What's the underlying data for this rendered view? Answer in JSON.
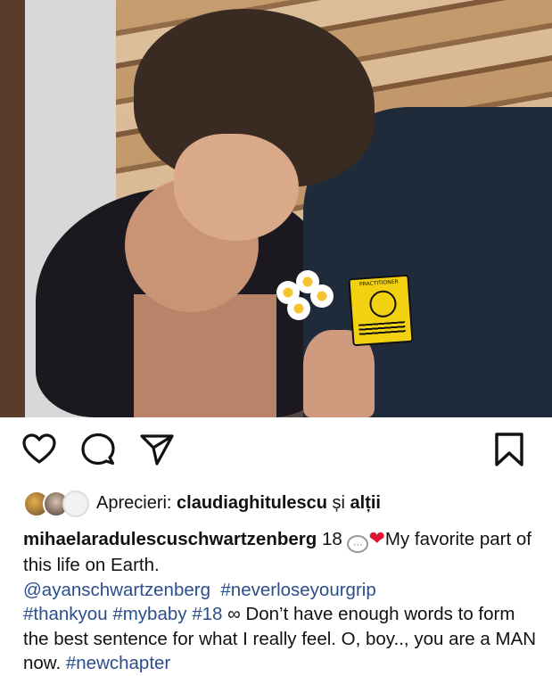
{
  "post": {
    "photo_badge_text": "PRACTITIONER",
    "likes": {
      "prefix": "Aprecieri: ",
      "user": "claudiaghitulescu",
      "conj": " și ",
      "others": "alții"
    },
    "caption": {
      "username": "mihaelaradulescuschwartzenberg",
      "number": " 18 ",
      "speech_bubble": "···",
      "heart": "❤",
      "line1": "My favorite part of this life on Earth.",
      "mention": "@ayanschwartzenberg",
      "tag1": "#neverloseyourgrip",
      "tag2": "#thankyou",
      "tag3": "#mybaby",
      "tag4": "#18",
      "infinity": "∞",
      "body": " Don’t have enough words to form the best sentence for what I really feel. O, boy.., you are a MAN now. ",
      "tag5": "#newchapter"
    }
  },
  "icons": {
    "like": "heart-outline-icon",
    "comment": "comment-bubble-icon",
    "share": "paper-plane-icon",
    "save": "bookmark-icon"
  },
  "colors": {
    "link": "#2a4d8c",
    "heart": "#e0152f",
    "text": "#111111"
  }
}
